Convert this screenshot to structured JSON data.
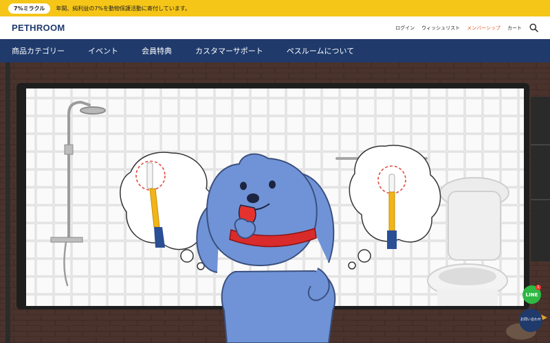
{
  "topbar": {
    "pill": "7%ミラクル",
    "message": "年間、純利益の7%を動物保護活動に寄付しています。"
  },
  "header": {
    "logo": "PETHROOM",
    "links": [
      "ログイン",
      "ウィッシュリスト",
      "メンバーシップ",
      "カート"
    ],
    "search_icon": "search-icon"
  },
  "nav": {
    "items": [
      "商品カテゴリー",
      "イベント",
      "会員特典",
      "カスタマーサポート",
      "ペスルームについて"
    ]
  },
  "floating": {
    "line_label": "LINE",
    "line_badge": "1",
    "contact_label": "お問い合わせ"
  },
  "colors": {
    "topbar": "#f5c518",
    "nav": "#1f3a6b",
    "accent": "#e8541e",
    "dog": "#6f93d6",
    "collar": "#d92b2b"
  }
}
